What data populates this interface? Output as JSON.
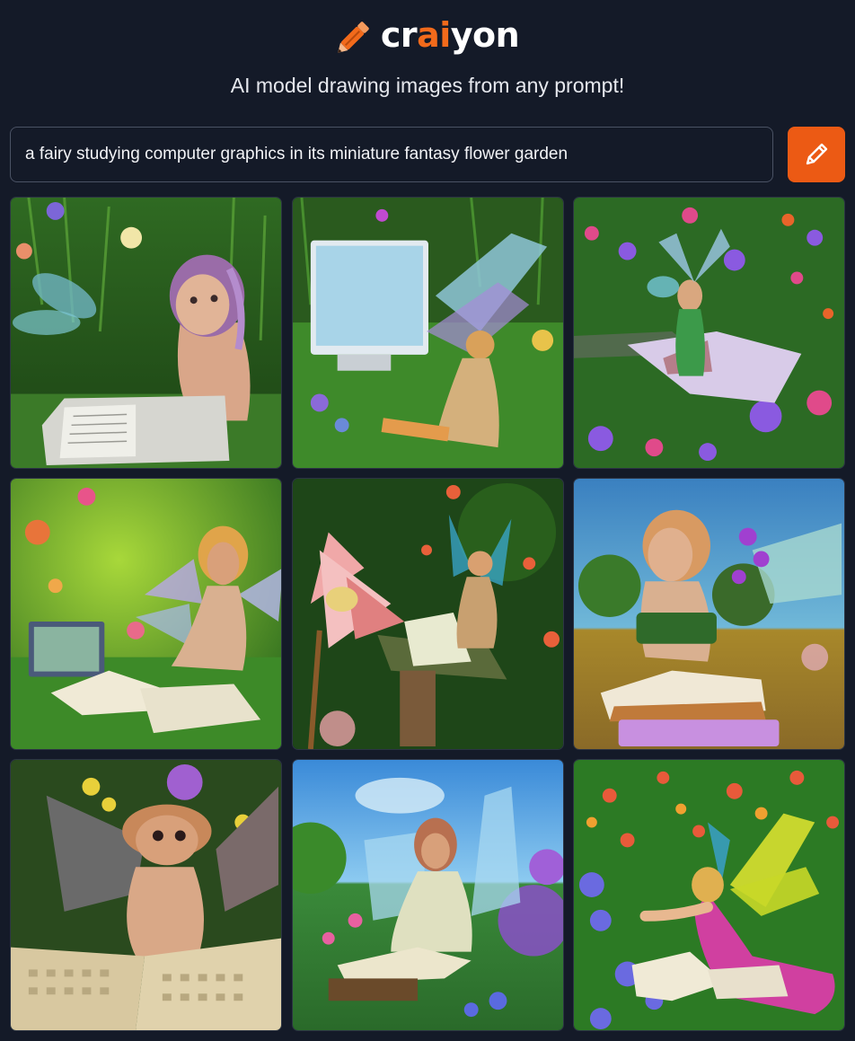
{
  "app": {
    "logo_prefix": "cr",
    "logo_accent": "ai",
    "logo_suffix": "yon",
    "tagline": "AI model drawing images from any prompt!",
    "accent_color": "#ec5a14",
    "background_color": "#141a28"
  },
  "prompt": {
    "value": "a fairy studying computer graphics in its miniature fantasy flower garden"
  },
  "draw_button": {
    "icon": "pencil-icon"
  },
  "results": [
    {
      "id": "result-1",
      "scene": "fairy-with-laptop"
    },
    {
      "id": "result-2",
      "scene": "fairy-with-monitor"
    },
    {
      "id": "result-3",
      "scene": "fairy-on-book"
    },
    {
      "id": "result-4",
      "scene": "fairy-with-laptop-and-books"
    },
    {
      "id": "result-5",
      "scene": "fairy-at-table"
    },
    {
      "id": "result-6",
      "scene": "fairy-reading-book"
    },
    {
      "id": "result-7",
      "scene": "fairy-with-keyboard"
    },
    {
      "id": "result-8",
      "scene": "fairy-sitting-blue-sky"
    },
    {
      "id": "result-9",
      "scene": "fairy-with-yellow-wings"
    }
  ]
}
